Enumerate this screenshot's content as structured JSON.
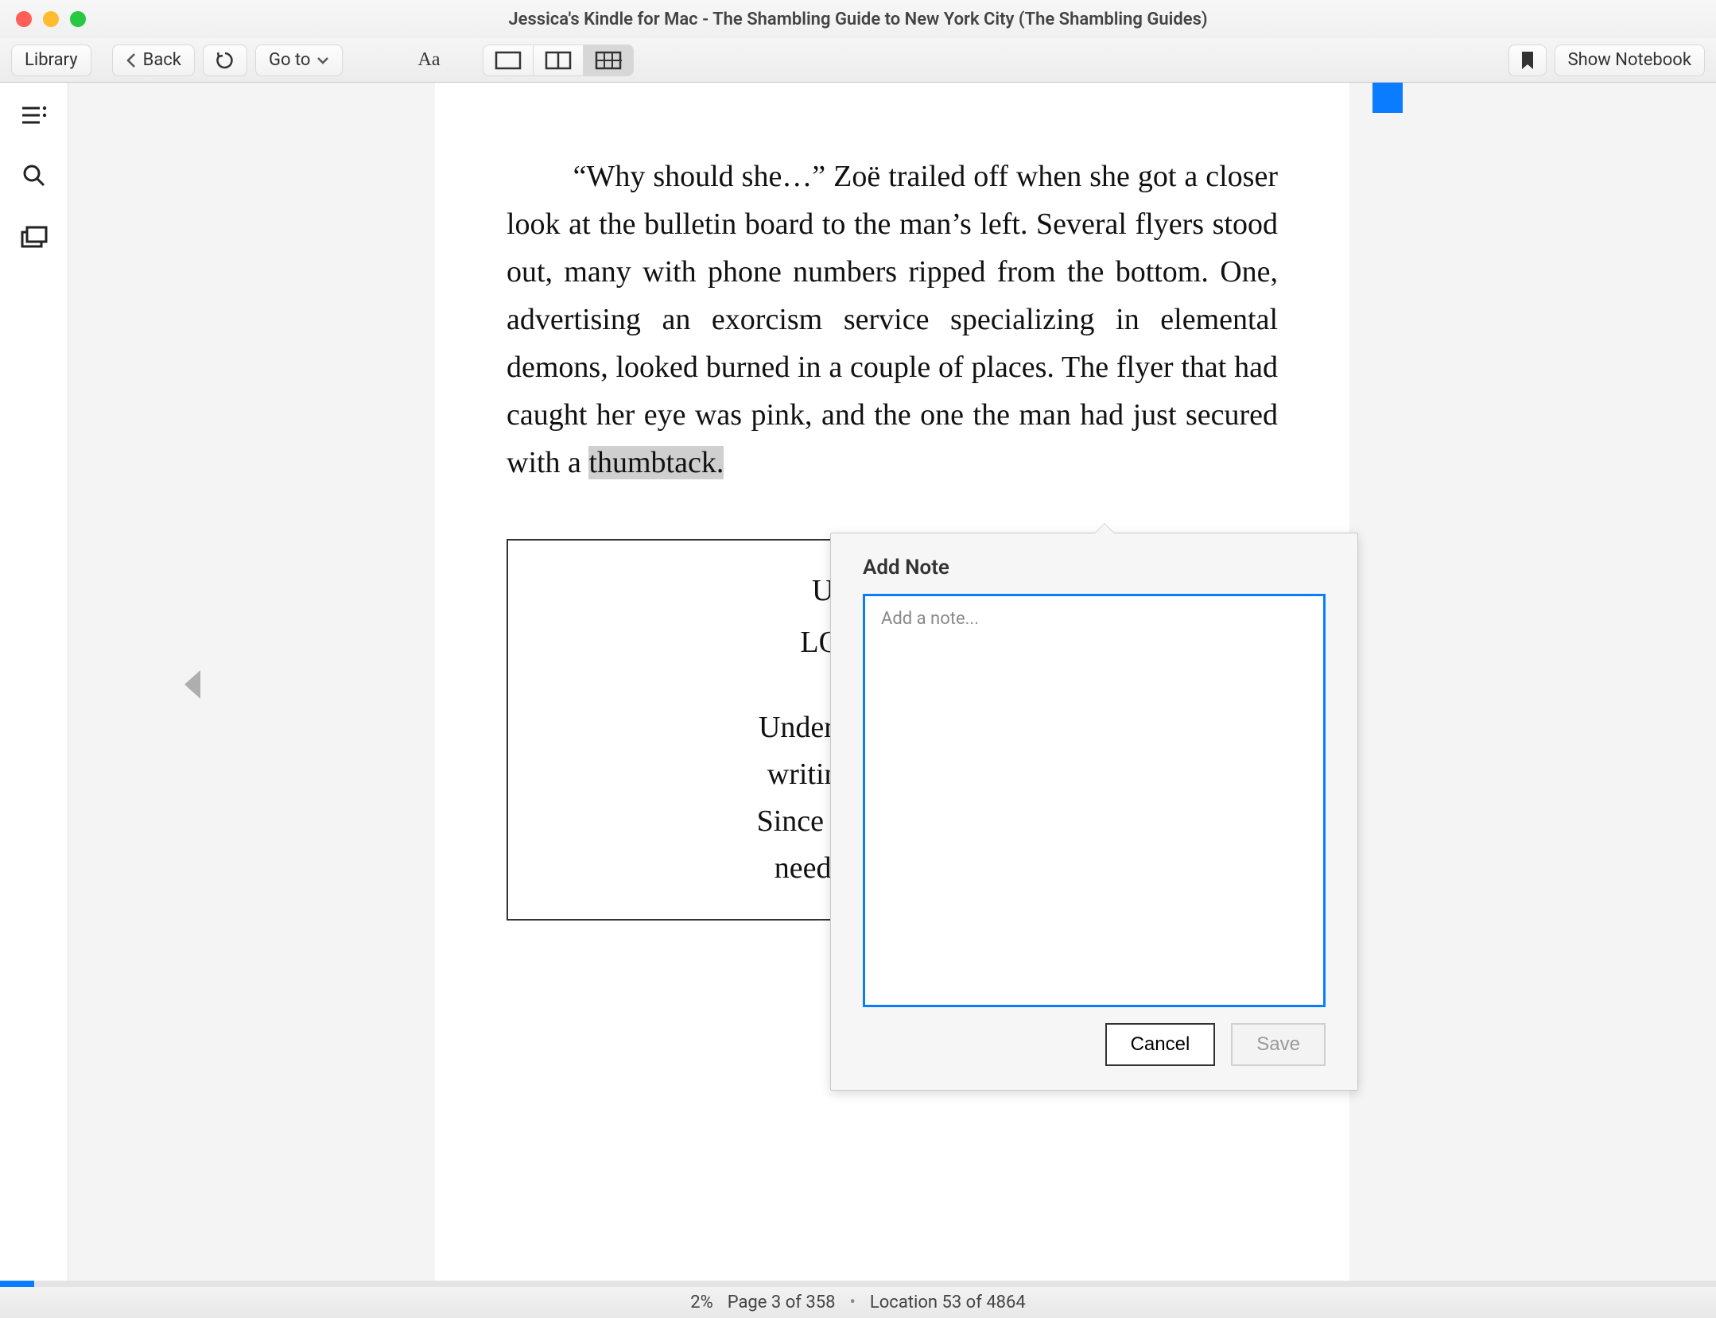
{
  "window": {
    "title": "Jessica's Kindle for Mac - The Shambling Guide to New York City (The Shambling Guides)"
  },
  "toolbar": {
    "library_label": "Library",
    "back_label": "Back",
    "goto_label": "Go to",
    "show_notebook_label": "Show Notebook"
  },
  "page_text": {
    "before_highlight": "“Why should she…” Zoë trailed off when she got a closer look at the bulletin board to the man’s left. Several flyers stood out, many with phone numbers ripped from the bottom. One, advertis­ing an exorcism service specializing in elemental demons, looked burned in a couple of places. The flyer that had caught her eye was pink, and the one the man had just secured with a ",
    "highlight": "thumbtack.",
    "flyer": {
      "line1": "Underground",
      "line2": "LOOKING FO",
      "line3a": "Underground Publishi",
      "line3b": "writing travel guides",
      "line3c": "Since we’re writing fo",
      "line3d": "need people like yo"
    }
  },
  "popover": {
    "title": "Add Note",
    "placeholder": "Add a note...",
    "cancel_label": "Cancel",
    "save_label": "Save"
  },
  "status": {
    "percent": "2%",
    "page": "Page 3 of 358",
    "location": "Location 53 of 4864",
    "progress_pct": 2
  }
}
